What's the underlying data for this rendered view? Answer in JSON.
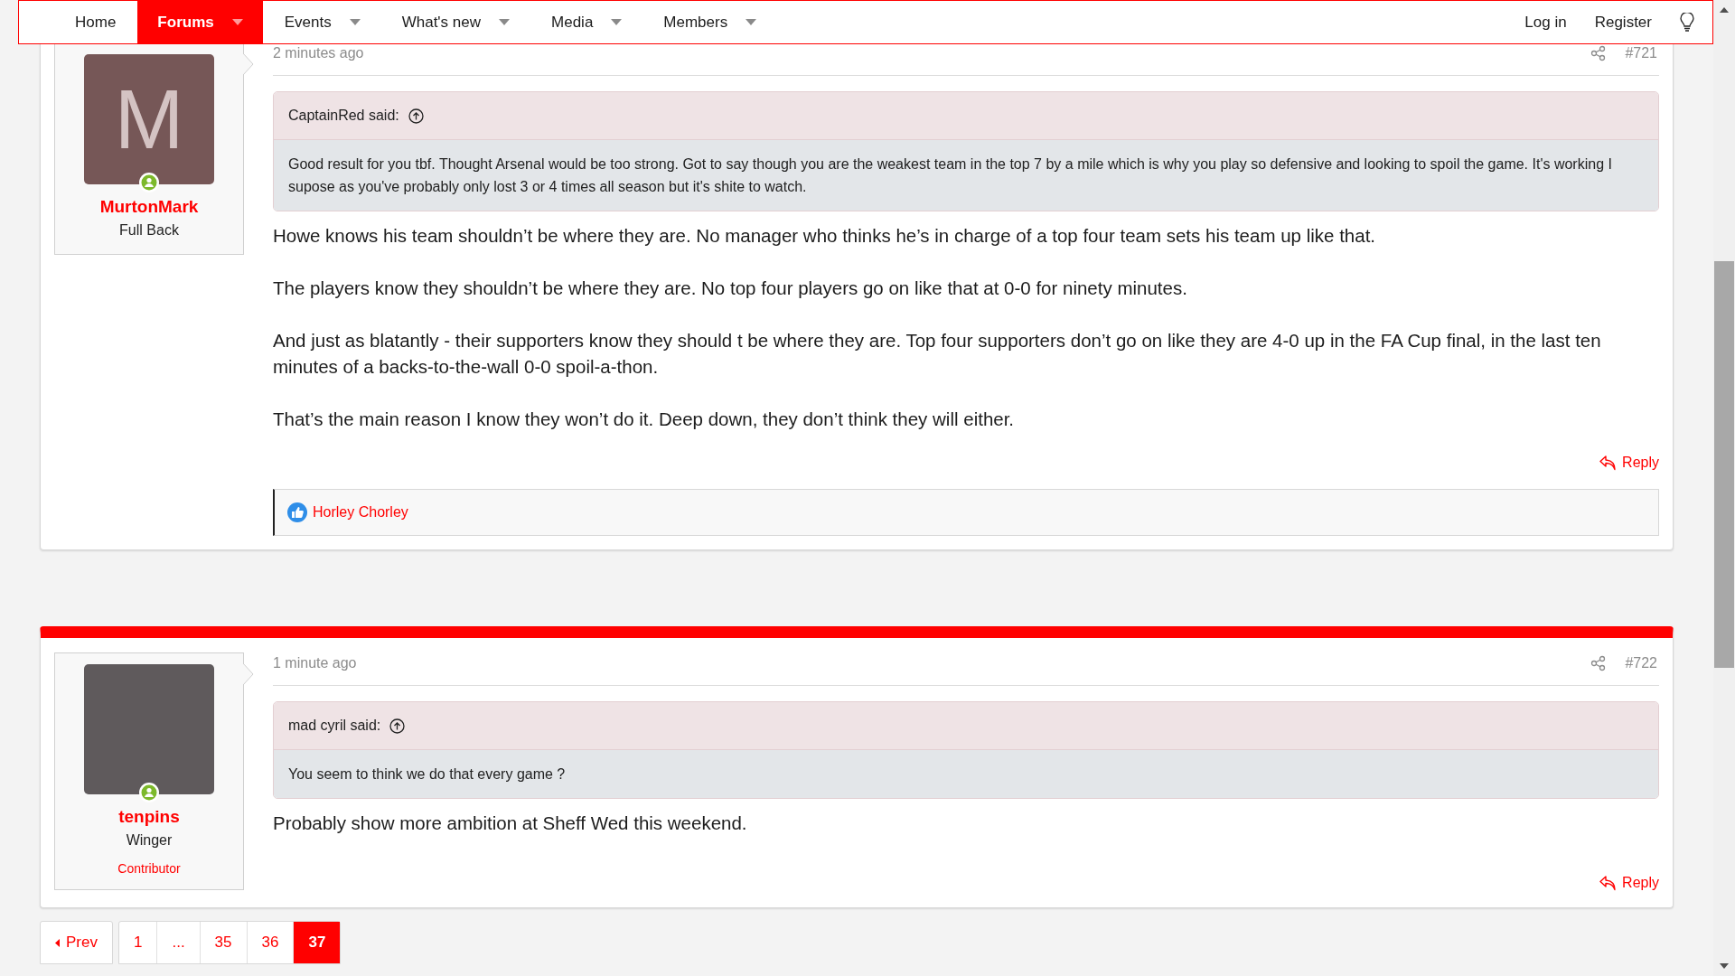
{
  "nav": {
    "items": [
      {
        "label": "Home",
        "selected": false,
        "dropdown": false
      },
      {
        "label": "Forums",
        "selected": true,
        "dropdown": true
      },
      {
        "label": "Events",
        "selected": false,
        "dropdown": true
      },
      {
        "label": "What's new",
        "selected": false,
        "dropdown": true
      },
      {
        "label": "Media",
        "selected": false,
        "dropdown": true
      },
      {
        "label": "Members",
        "selected": false,
        "dropdown": true
      }
    ],
    "right": [
      "Log in",
      "Register"
    ]
  },
  "posts": [
    {
      "highlighted": false,
      "time": "2 minutes ago",
      "number": "#721",
      "user": {
        "name": "MurtonMark",
        "title": "Full Back",
        "online": true,
        "avatar": {
          "kind": "letter",
          "letter": "M"
        }
      },
      "quote": {
        "author": "CaptainRed said:",
        "text": "Good result for you tbf. Thought Arsenal would be too strong. Got to say though you are the weakest team in the top 7 by a mile which is why you play so defensive and looking to spoil the game. It's working I supose as you've probably only lost 3 or 4 times all season but it's shite to watch."
      },
      "paragraphs": [
        "Howe knows his team shouldn’t be where they are. No manager who thinks he’s in charge of a top four team sets his team up like that.",
        "The players know they shouldn’t be where they are. No top four players go on like that at 0-0 for ninety minutes.",
        "And just as blatantly - their supporters know they should t be where they are. Top four supporters don’t go on like they are 4-0 up in the FA Cup final, in the last ten minutes of a backs-to-the-wall 0-0 spoil-a-thon.",
        "That’s the main reason I know they won’t do it. Deep down, they don’t think they will either."
      ],
      "reply": "Reply",
      "reactions": [
        "Horley Chorley"
      ]
    },
    {
      "highlighted": true,
      "time": "1 minute ago",
      "number": "#722",
      "user": {
        "name": "tenpins",
        "title": "Winger",
        "banner": "Contributor",
        "online": true,
        "avatar": {
          "kind": "photo"
        }
      },
      "quote": {
        "author": "mad cyril said:",
        "text": "You seem to think we do that every game ?"
      },
      "paragraphs": [
        "Probably show more ambition at Sheff Wed this weekend."
      ],
      "reply": "Reply"
    }
  ],
  "pagination": {
    "prev": "Prev",
    "pages": [
      {
        "label": "1",
        "selected": false
      },
      {
        "label": "...",
        "selected": false
      },
      {
        "label": "35",
        "selected": false
      },
      {
        "label": "36",
        "selected": false
      },
      {
        "label": "37",
        "selected": true
      }
    ]
  }
}
